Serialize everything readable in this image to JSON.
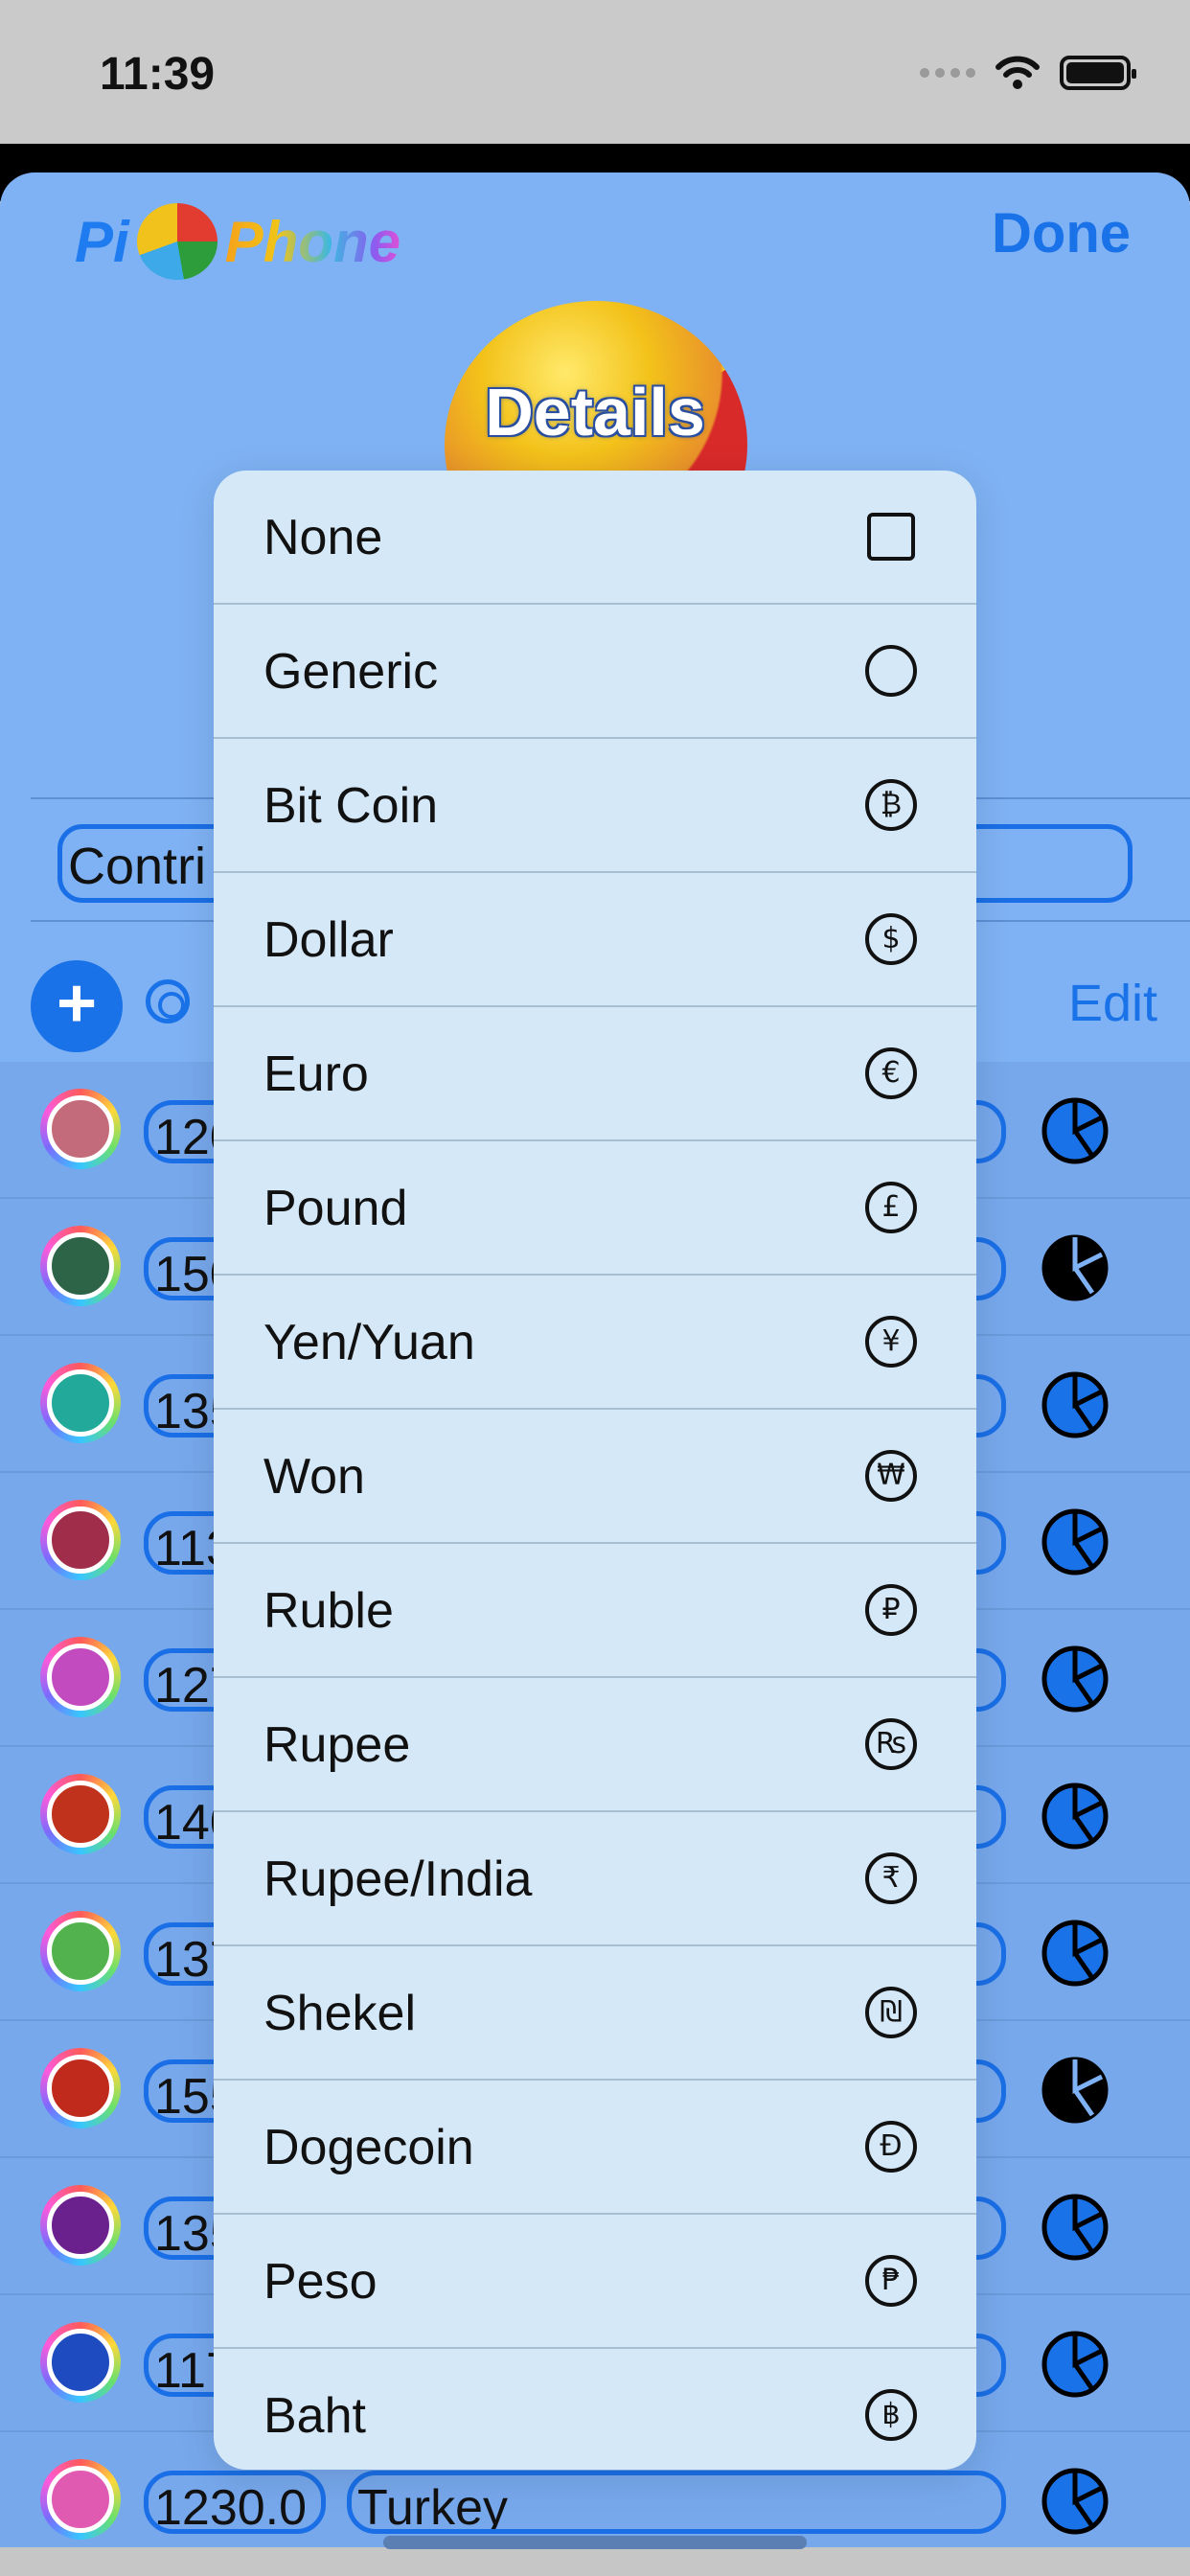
{
  "status_bar": {
    "time": "11:39"
  },
  "header": {
    "logo_left": "Pi",
    "logo_right": "Phone",
    "done_label": "Done",
    "title": "Details"
  },
  "name_field": {
    "value": "Contri"
  },
  "toolbar": {
    "add_label": "+",
    "edit_label": "Edit"
  },
  "rows": [
    {
      "value": "120",
      "label": "",
      "color": "#c36b7a",
      "pie_style": "blue"
    },
    {
      "value": "150",
      "label": "",
      "color": "#2d6447",
      "pie_style": "black"
    },
    {
      "value": "135",
      "label": "",
      "color": "#22a99a",
      "pie_style": "blue"
    },
    {
      "value": "113",
      "label": "",
      "color": "#a02d4a",
      "pie_style": "blue"
    },
    {
      "value": "127",
      "label": "",
      "color": "#c24bc0",
      "pie_style": "blue"
    },
    {
      "value": "140",
      "label": "",
      "color": "#c0321c",
      "pie_style": "blue"
    },
    {
      "value": "137",
      "label": "",
      "color": "#52b34e",
      "pie_style": "blue"
    },
    {
      "value": "155",
      "label": "",
      "color": "#c02a1c",
      "pie_style": "black"
    },
    {
      "value": "135",
      "label": "",
      "color": "#6a218e",
      "pie_style": "blue"
    },
    {
      "value": "117",
      "label": "",
      "color": "#1e4bbf",
      "pie_style": "blue"
    },
    {
      "value": "1230.0",
      "label": "Turkey",
      "color": "#e05ab2",
      "pie_style": "blue"
    }
  ],
  "menu": {
    "items": [
      {
        "label": "None",
        "icon": "none-icon",
        "glyph": ""
      },
      {
        "label": "Generic",
        "icon": "circle-icon",
        "glyph": ""
      },
      {
        "label": "Bit Coin",
        "icon": "bitcoin-icon",
        "glyph": "₿"
      },
      {
        "label": "Dollar",
        "icon": "dollar-icon",
        "glyph": "$"
      },
      {
        "label": "Euro",
        "icon": "euro-icon",
        "glyph": "€"
      },
      {
        "label": "Pound",
        "icon": "pound-icon",
        "glyph": "£"
      },
      {
        "label": "Yen/Yuan",
        "icon": "yen-icon",
        "glyph": "¥"
      },
      {
        "label": "Won",
        "icon": "won-icon",
        "glyph": "₩"
      },
      {
        "label": "Ruble",
        "icon": "ruble-icon",
        "glyph": "₽"
      },
      {
        "label": "Rupee",
        "icon": "rupee-icon",
        "glyph": "₨"
      },
      {
        "label": "Rupee/India",
        "icon": "rupee-india-icon",
        "glyph": "₹"
      },
      {
        "label": "Shekel",
        "icon": "shekel-icon",
        "glyph": "₪"
      },
      {
        "label": "Dogecoin",
        "icon": "dogecoin-icon",
        "glyph": "Đ"
      },
      {
        "label": "Peso",
        "icon": "peso-icon",
        "glyph": "₱"
      },
      {
        "label": "Baht",
        "icon": "baht-icon",
        "glyph": "฿"
      }
    ]
  }
}
